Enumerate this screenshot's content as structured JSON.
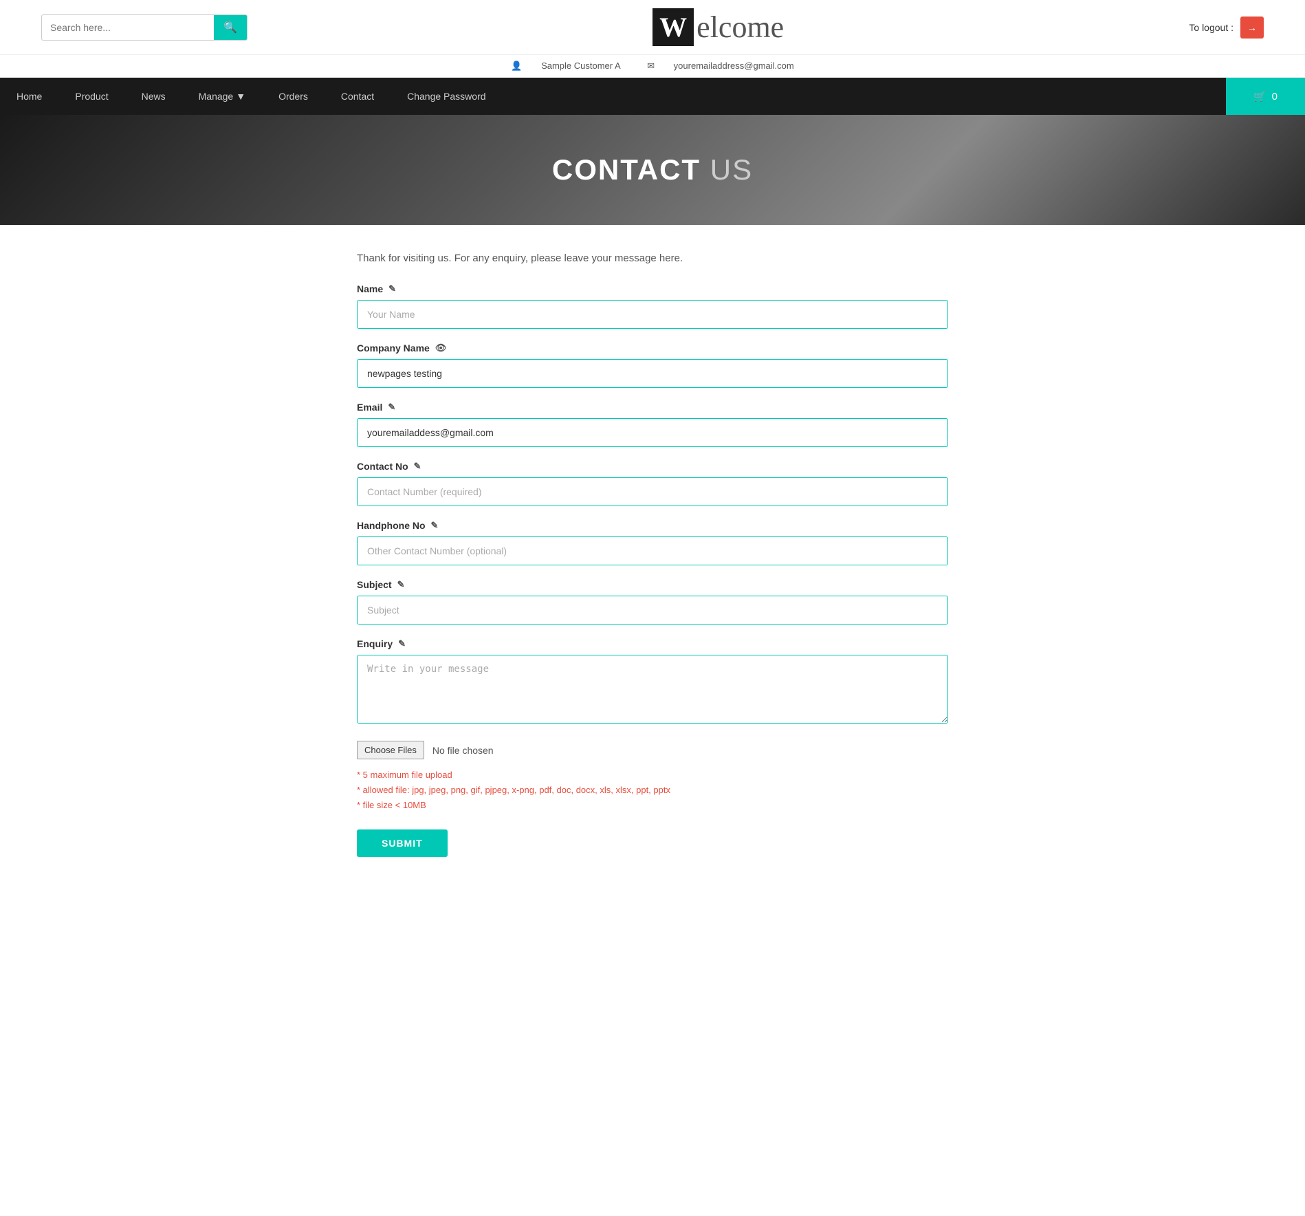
{
  "header": {
    "search_placeholder": "Search here...",
    "search_icon": "🔍",
    "logo_w": "W",
    "logo_rest": "elcome",
    "logout_label": "To logout :",
    "logout_icon": "→"
  },
  "user_info": {
    "customer_icon": "👤",
    "customer_name": "Sample Customer A",
    "email_icon": "✉",
    "email": "youremailaddress@gmail.com"
  },
  "nav": {
    "items": [
      {
        "label": "Home",
        "has_dropdown": false
      },
      {
        "label": "Product",
        "has_dropdown": false
      },
      {
        "label": "News",
        "has_dropdown": false
      },
      {
        "label": "Manage",
        "has_dropdown": true
      },
      {
        "label": "Orders",
        "has_dropdown": false
      },
      {
        "label": "Contact",
        "has_dropdown": false
      },
      {
        "label": "Change Password",
        "has_dropdown": false
      }
    ],
    "cart_icon": "🛒",
    "cart_count": "0"
  },
  "hero": {
    "title_bold": "CONTACT",
    "title_light": " US"
  },
  "form": {
    "intro": "Thank for visiting us. For any enquiry, please leave your message here.",
    "fields": [
      {
        "label": "Name",
        "has_edit_icon": true,
        "placeholder": "Your Name",
        "value": "",
        "type": "text",
        "name": "name"
      },
      {
        "label": "Company Name",
        "has_view_icon": true,
        "placeholder": "",
        "value": "newpages testing",
        "type": "text",
        "name": "company_name"
      },
      {
        "label": "Email",
        "has_edit_icon": true,
        "placeholder": "",
        "value": "youremailaddess@gmail.com",
        "type": "text",
        "name": "email"
      },
      {
        "label": "Contact No",
        "has_edit_icon": true,
        "placeholder": "Contact Number (required)",
        "value": "",
        "type": "text",
        "name": "contact_no"
      },
      {
        "label": "Handphone No",
        "has_edit_icon": true,
        "placeholder": "Other Contact Number (optional)",
        "value": "",
        "type": "text",
        "name": "handphone_no"
      },
      {
        "label": "Subject",
        "has_edit_icon": true,
        "placeholder": "Subject",
        "value": "",
        "type": "text",
        "name": "subject"
      }
    ],
    "enquiry": {
      "label": "Enquiry",
      "has_edit_icon": true,
      "placeholder": "Write in your message",
      "value": "",
      "name": "enquiry"
    },
    "file_upload": {
      "button_label": "Choose Files",
      "no_file_text": "No file chosen"
    },
    "file_notes": [
      "* 5 maximum file upload",
      "* allowed file: jpg, jpeg, png, gif, pjpeg, x-png, pdf, doc, docx, xls, xlsx, ppt, pptx",
      "* file size < 10MB"
    ],
    "submit_label": "SUBMIT"
  }
}
